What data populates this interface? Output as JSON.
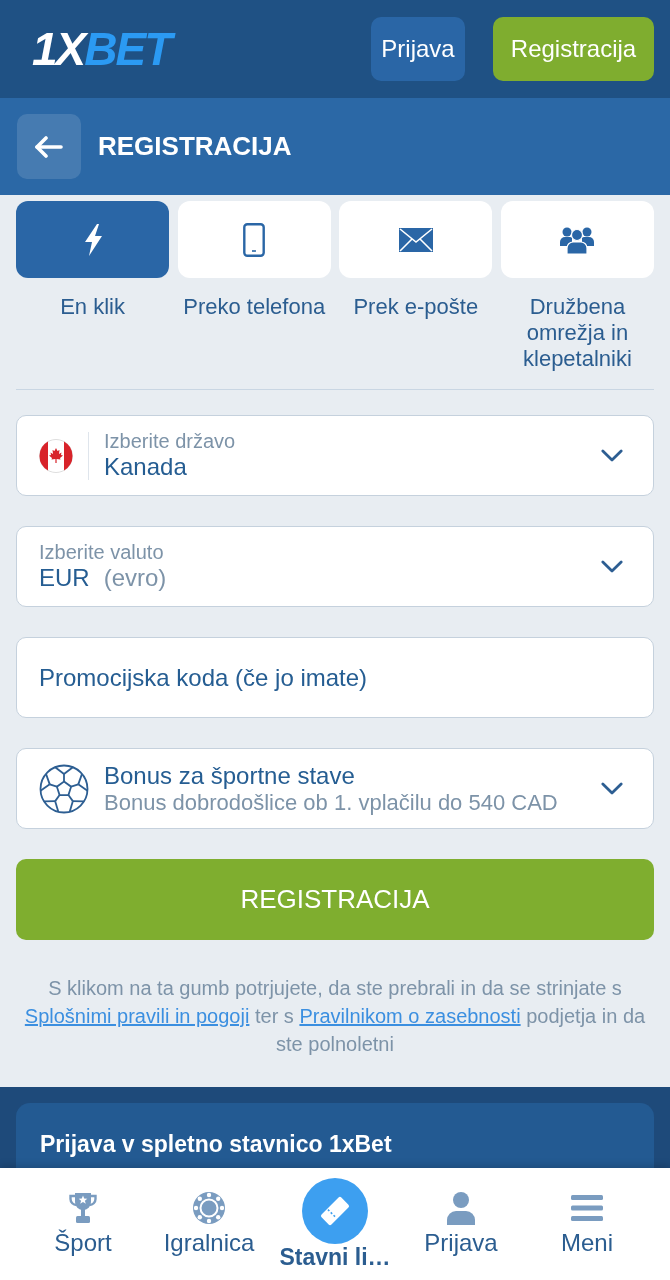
{
  "header": {
    "logo": {
      "lead": "1X",
      "accent": "BET"
    },
    "buttons": [
      {
        "kind": "login",
        "label": "Prijava"
      },
      {
        "kind": "register",
        "label": "Registracija"
      }
    ]
  },
  "title_bar": {
    "title": "REGISTRACIJA"
  },
  "methods": [
    {
      "kind": "bolt",
      "label": "En klik",
      "selected": true
    },
    {
      "kind": "phone",
      "label": "Preko telefona",
      "selected": false
    },
    {
      "kind": "mail",
      "label": "Prek e-pošte",
      "selected": false
    },
    {
      "kind": "people",
      "label": "Družbena omrežja in klepetalniki",
      "selected": false
    }
  ],
  "fields": [
    {
      "kind": "country",
      "label": "Izberite državo",
      "value": "Kanada"
    },
    {
      "kind": "currency",
      "label": "Izberite valuto",
      "value": "EUR",
      "note": "(evro)"
    },
    {
      "kind": "promo",
      "placeholder": "Promocijska koda (če jo imate)"
    },
    {
      "kind": "bonus",
      "title": "Bonus za športne stave",
      "subtitle": "Bonus dobrodošlice ob 1. vplačilu do 540 CAD"
    }
  ],
  "submit_button": {
    "label": "REGISTRACIJA"
  },
  "terms": [
    {
      "kind": "text",
      "text": "S klikom na ta gumb potrjujete, da ste prebrali in da se strinjate s "
    },
    {
      "kind": "link",
      "text": "Splošnimi pravili in pogoji"
    },
    {
      "kind": "text",
      "text": " ter s "
    },
    {
      "kind": "link",
      "text": "Pravilnikom o zasebnosti"
    },
    {
      "kind": "text",
      "text": " podjetja in da ste polnoletni"
    }
  ],
  "footer_card": {
    "title": "Prijava v spletno stavnico 1xBet"
  },
  "bottom_nav": [
    {
      "kind": "trophy",
      "label": "Šport",
      "selected": false
    },
    {
      "kind": "chip",
      "label": "Igralnica",
      "selected": false
    },
    {
      "kind": "ticket",
      "label": "Stavni li…",
      "selected": true
    },
    {
      "kind": "person",
      "label": "Prijava",
      "selected": false
    },
    {
      "kind": "menu",
      "label": "Meni",
      "selected": false
    }
  ]
}
